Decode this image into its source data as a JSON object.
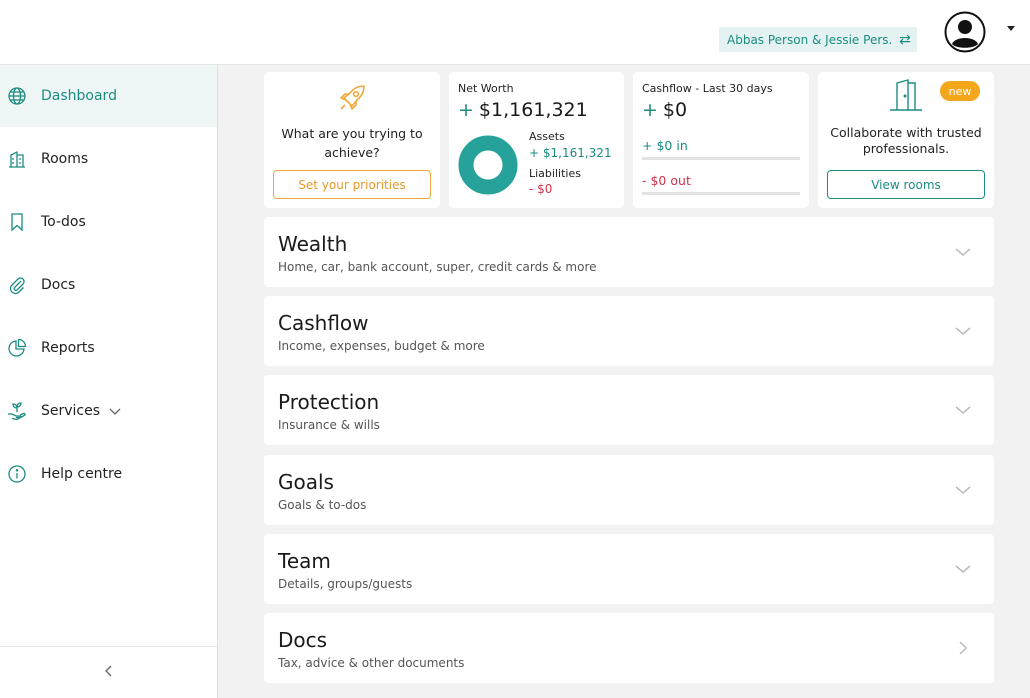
{
  "header": {
    "household": "Abbas Person & Jessie Pers...",
    "swap_icon": "swap-icon",
    "avatar_icon": "user-avatar-icon"
  },
  "sidebar": {
    "items": [
      {
        "label": "Dashboard",
        "icon": "globe-icon",
        "active": true
      },
      {
        "label": "Rooms",
        "icon": "building-icon"
      },
      {
        "label": "To-dos",
        "icon": "bookmark-icon"
      },
      {
        "label": "Docs",
        "icon": "paperclip-icon"
      },
      {
        "label": "Reports",
        "icon": "pie-chart-icon"
      },
      {
        "label": "Services",
        "icon": "plant-hand-icon",
        "has_dropdown": true
      },
      {
        "label": "Help centre",
        "icon": "info-icon"
      }
    ],
    "collapse_icon": "chevron-left-icon"
  },
  "cards": {
    "priorities": {
      "question": "What are you trying to achieve?",
      "button": "Set your priorities"
    },
    "net_worth": {
      "label": "Net Worth",
      "sign": "+",
      "value": "$1,161,321",
      "assets_label": "Assets",
      "assets_value": "+ $1,161,321",
      "liabilities_label": "Liabilities",
      "liabilities_value": "- $0"
    },
    "cashflow": {
      "label": "Cashflow - Last 30 days",
      "sign": "+",
      "value": "$0",
      "in_value": "+ $0",
      "in_label": "in",
      "out_value": "- $0",
      "out_label": "out"
    },
    "collaborate": {
      "badge": "new",
      "text": "Collaborate with trusted professionals.",
      "button": "View rooms"
    }
  },
  "sections": [
    {
      "title": "Wealth",
      "subtitle": "Home, car, bank account, super, credit cards & more",
      "arrow": "chevron-down-icon"
    },
    {
      "title": "Cashflow",
      "subtitle": "Income, expenses, budget & more",
      "arrow": "chevron-down-icon"
    },
    {
      "title": "Protection",
      "subtitle": "Insurance & wills",
      "arrow": "chevron-down-icon"
    },
    {
      "title": "Goals",
      "subtitle": "Goals & to-dos",
      "arrow": "chevron-down-icon"
    },
    {
      "title": "Team",
      "subtitle": "Details, groups/guests",
      "arrow": "chevron-down-icon"
    },
    {
      "title": "Docs",
      "subtitle": "Tax, advice & other documents",
      "arrow": "chevron-right-icon"
    }
  ],
  "colors": {
    "accent": "#1c8c81",
    "orange": "#f0a93b",
    "negative": "#d0334a",
    "background": "#f2f2f2"
  }
}
